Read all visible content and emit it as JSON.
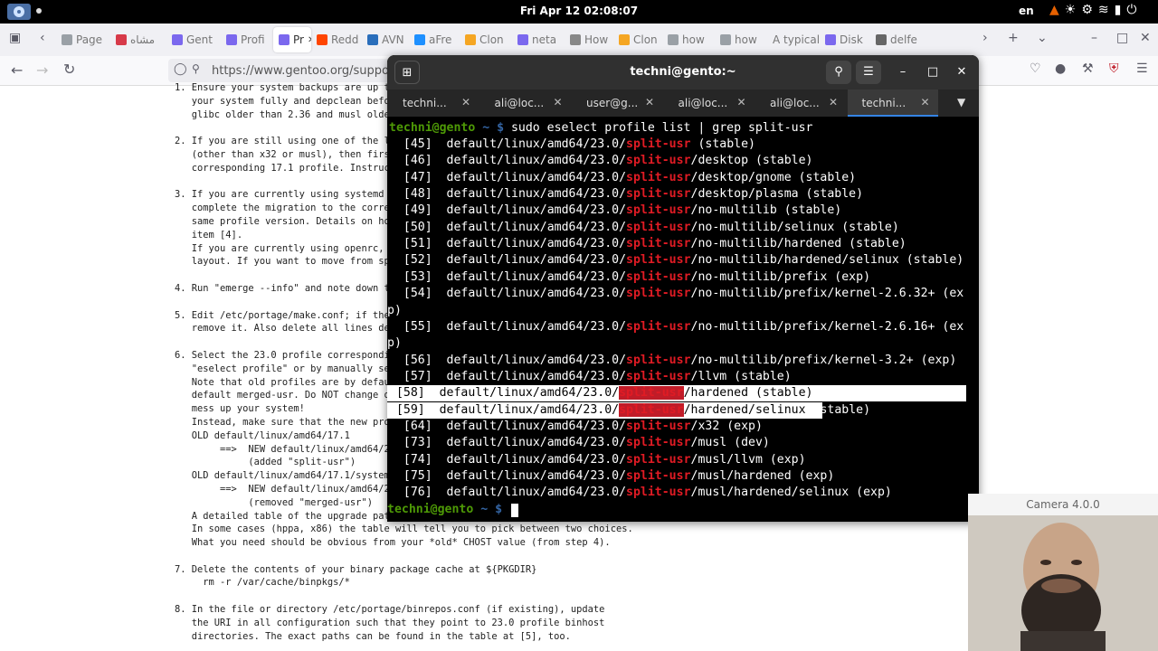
{
  "topbar": {
    "clock": "Fri Apr 12  02:08:07",
    "language": "en"
  },
  "browser": {
    "tabs": [
      {
        "label": "Page",
        "color": "#9aa0a6"
      },
      {
        "label": "مشاه",
        "color": "#d73a49"
      },
      {
        "label": "Gent",
        "color": "#7b68ee"
      },
      {
        "label": "Profi",
        "color": "#7b68ee"
      },
      {
        "label": "Pr",
        "color": "#7b68ee"
      },
      {
        "label": "Redd",
        "color": "#ff4500"
      },
      {
        "label": "AVN",
        "color": "#2a6ebb"
      },
      {
        "label": "aFre",
        "color": "#1e90ff"
      },
      {
        "label": "Clon",
        "color": "#f5a623"
      },
      {
        "label": "neta",
        "color": "#7b68ee"
      },
      {
        "label": "How",
        "color": "#888888"
      },
      {
        "label": "Clon",
        "color": "#f5a623"
      },
      {
        "label": "how",
        "color": "#9aa0a6"
      },
      {
        "label": "how",
        "color": "#9aa0a6"
      },
      {
        "label": "A typical",
        "color": "#ffffff"
      },
      {
        "label": "Disk",
        "color": "#7b68ee"
      },
      {
        "label": "delfe",
        "color": "#666666"
      }
    ],
    "url": "https://www.gentoo.org/support/ne"
  },
  "news_lines": [
    "1. Ensure your system backups are up t",
    "   your system fully and depclean befo",
    "   glibc older than 2.36 and musl olde",
    "",
    "2. If you are still using one of the l",
    "   (other than x32 or musl), then firs",
    "   corresponding 17.1 profile. Instruc",
    "",
    "3. If you are currently using systemd ",
    "   complete the migration to the corre",
    "   same profile version. Details on ho",
    "   item [4].",
    "   If you are currently using openrc, ",
    "   layout. If you want to move from sp",
    "",
    "4. Run \"emerge --info\" and note down t",
    "",
    "5. Edit /etc/portage/make.conf; if the",
    "   remove it. Also delete all lines de",
    "",
    "6. Select the 23.0 profile correspondi",
    "   \"eselect profile\" or by manually se",
    "   Note that old profiles are by defau",
    "   default merged-usr. Do NOT change o",
    "   mess up your system!",
    "   Instead, make sure that the new pro",
    "   OLD default/linux/amd64/17.1",
    "        ==>  NEW default/linux/amd64/2",
    "             (added \"split-usr\")",
    "   OLD default/linux/amd64/17.1/system",
    "        ==>  NEW default/linux/amd64/2",
    "             (removed \"merged-usr\")",
    "   A detailed table of the upgrade pat",
    "   In some cases (hppa, x86) the table will tell you to pick between two choices.",
    "   What you need should be obvious from your *old* CHOST value (from step 4).",
    "",
    "7. Delete the contents of your binary package cache at ${PKGDIR}",
    "     rm -r /var/cache/binpkgs/*",
    "",
    "8. In the file or directory /etc/portage/binrepos.conf (if existing), update",
    "   the URI in all configuration such that they point to 23.0 profile binhost",
    "   directories. The exact paths can be found in the table at [5], too."
  ],
  "terminal": {
    "title": "techni@gento:~",
    "tabs": [
      "techni...",
      "ali@loc...",
      "user@g...",
      "ali@loc...",
      "ali@loc...",
      "techni..."
    ],
    "active_tab": 5,
    "prompt_user": "techni@gento",
    "prompt_dir": " ~ $ ",
    "command": "sudo eselect profile list | grep split-usr",
    "base": "default/linux/amd64/23.0/",
    "match": "split-usr",
    "rows": [
      {
        "num": "[45]",
        "rest": " (stable)"
      },
      {
        "num": "[46]",
        "rest": "/desktop (stable)"
      },
      {
        "num": "[47]",
        "rest": "/desktop/gnome (stable)"
      },
      {
        "num": "[48]",
        "rest": "/desktop/plasma (stable)"
      },
      {
        "num": "[49]",
        "rest": "/no-multilib (stable)"
      },
      {
        "num": "[50]",
        "rest": "/no-multilib/selinux (stable)"
      },
      {
        "num": "[51]",
        "rest": "/no-multilib/hardened (stable)"
      },
      {
        "num": "[52]",
        "rest": "/no-multilib/hardened/selinux (stable)"
      },
      {
        "num": "[53]",
        "rest": "/no-multilib/prefix (exp)"
      },
      {
        "num": "[54]",
        "rest": "/no-multilib/prefix/kernel-2.6.32+ (ex",
        "wrap": "p)"
      },
      {
        "num": "[55]",
        "rest": "/no-multilib/prefix/kernel-2.6.16+ (ex",
        "wrap": "p)"
      },
      {
        "num": "[56]",
        "rest": "/no-multilib/prefix/kernel-3.2+ (exp)"
      },
      {
        "num": "[57]",
        "rest": "/llvm (stable)"
      },
      {
        "num": "[58]",
        "rest": "/hardened (stable)",
        "selected": "full"
      },
      {
        "num": "[59]",
        "rest": "/hardened/selinux",
        "after": " (stable)",
        "selected": "partial"
      },
      {
        "num": "[64]",
        "rest": "/x32 (exp)"
      },
      {
        "num": "[73]",
        "rest": "/musl (dev)"
      },
      {
        "num": "[74]",
        "rest": "/musl/llvm (exp)"
      },
      {
        "num": "[75]",
        "rest": "/musl/hardened (exp)"
      },
      {
        "num": "[76]",
        "rest": "/musl/hardened/selinux (exp)"
      }
    ]
  },
  "camera": {
    "title": "Camera 4.0.0"
  }
}
